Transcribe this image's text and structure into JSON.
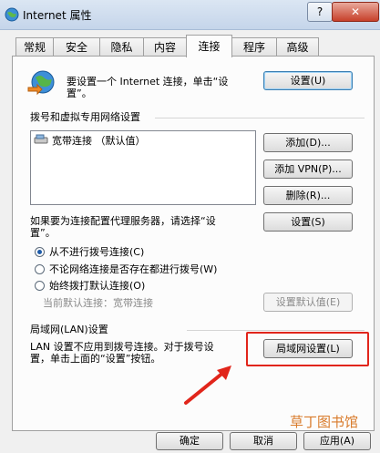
{
  "window": {
    "title": "Internet 属性",
    "help_glyph": "?",
    "close_glyph": "✕"
  },
  "tabs": [
    {
      "label": "常规"
    },
    {
      "label": "安全"
    },
    {
      "label": "隐私"
    },
    {
      "label": "内容"
    },
    {
      "label": "连接"
    },
    {
      "label": "程序"
    },
    {
      "label": "高级"
    }
  ],
  "setup": {
    "text_line1": "要设置一个 Internet 连接，单击“设",
    "text_line2": "置”。",
    "button": "设置(U)"
  },
  "dialup": {
    "heading": "拨号和虚拟专用网络设置",
    "list_item": "宽带连接 （默认值）",
    "add_button": "添加(D)...",
    "add_vpn_button": "添加 VPN(P)...",
    "delete_button": "删除(R)...",
    "proxy_text_line1": "如果要为连接配置代理服务器，请选择“设",
    "proxy_text_line2": "置”。",
    "settings_button": "设置(S)",
    "options": [
      {
        "label": "从不进行拨号连接(C)",
        "checked": true
      },
      {
        "label": "不论网络连接是否存在都进行拨号(W)",
        "checked": false
      },
      {
        "label": "始终拨打默认连接(O)",
        "checked": false
      }
    ],
    "current_default": "当前默认连接：宽带连接",
    "set_default_button": "设置默认值(E)"
  },
  "lan": {
    "heading": "局域网(LAN)设置",
    "text_line1": "LAN 设置不应用到拨号连接。对于拨号设",
    "text_line2": "置，单击上面的“设置”按钮。",
    "button": "局域网设置(L)"
  },
  "footer": {
    "ok": "确定",
    "cancel": "取消",
    "apply": "应用(A)"
  },
  "watermark": "草丁图书馆",
  "colors": {
    "annotation": "#e1251b"
  }
}
